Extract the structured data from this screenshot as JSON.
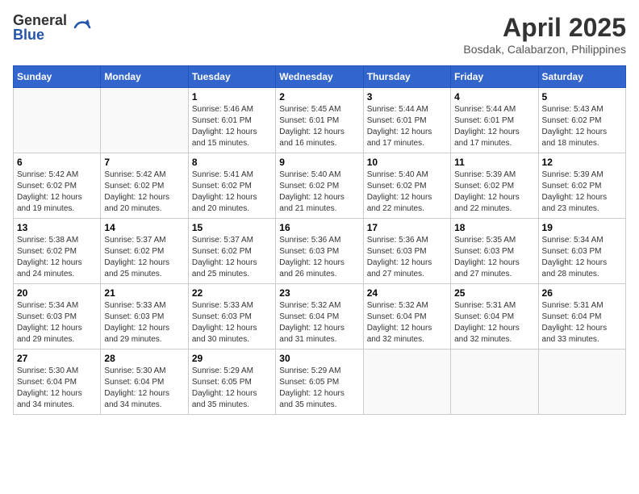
{
  "header": {
    "logo_general": "General",
    "logo_blue": "Blue",
    "title": "April 2025",
    "location": "Bosdak, Calabarzon, Philippines"
  },
  "weekdays": [
    "Sunday",
    "Monday",
    "Tuesday",
    "Wednesday",
    "Thursday",
    "Friday",
    "Saturday"
  ],
  "weeks": [
    [
      {
        "day": "",
        "info": ""
      },
      {
        "day": "",
        "info": ""
      },
      {
        "day": "1",
        "info": "Sunrise: 5:46 AM\nSunset: 6:01 PM\nDaylight: 12 hours and 15 minutes."
      },
      {
        "day": "2",
        "info": "Sunrise: 5:45 AM\nSunset: 6:01 PM\nDaylight: 12 hours and 16 minutes."
      },
      {
        "day": "3",
        "info": "Sunrise: 5:44 AM\nSunset: 6:01 PM\nDaylight: 12 hours and 17 minutes."
      },
      {
        "day": "4",
        "info": "Sunrise: 5:44 AM\nSunset: 6:01 PM\nDaylight: 12 hours and 17 minutes."
      },
      {
        "day": "5",
        "info": "Sunrise: 5:43 AM\nSunset: 6:02 PM\nDaylight: 12 hours and 18 minutes."
      }
    ],
    [
      {
        "day": "6",
        "info": "Sunrise: 5:42 AM\nSunset: 6:02 PM\nDaylight: 12 hours and 19 minutes."
      },
      {
        "day": "7",
        "info": "Sunrise: 5:42 AM\nSunset: 6:02 PM\nDaylight: 12 hours and 20 minutes."
      },
      {
        "day": "8",
        "info": "Sunrise: 5:41 AM\nSunset: 6:02 PM\nDaylight: 12 hours and 20 minutes."
      },
      {
        "day": "9",
        "info": "Sunrise: 5:40 AM\nSunset: 6:02 PM\nDaylight: 12 hours and 21 minutes."
      },
      {
        "day": "10",
        "info": "Sunrise: 5:40 AM\nSunset: 6:02 PM\nDaylight: 12 hours and 22 minutes."
      },
      {
        "day": "11",
        "info": "Sunrise: 5:39 AM\nSunset: 6:02 PM\nDaylight: 12 hours and 22 minutes."
      },
      {
        "day": "12",
        "info": "Sunrise: 5:39 AM\nSunset: 6:02 PM\nDaylight: 12 hours and 23 minutes."
      }
    ],
    [
      {
        "day": "13",
        "info": "Sunrise: 5:38 AM\nSunset: 6:02 PM\nDaylight: 12 hours and 24 minutes."
      },
      {
        "day": "14",
        "info": "Sunrise: 5:37 AM\nSunset: 6:02 PM\nDaylight: 12 hours and 25 minutes."
      },
      {
        "day": "15",
        "info": "Sunrise: 5:37 AM\nSunset: 6:02 PM\nDaylight: 12 hours and 25 minutes."
      },
      {
        "day": "16",
        "info": "Sunrise: 5:36 AM\nSunset: 6:03 PM\nDaylight: 12 hours and 26 minutes."
      },
      {
        "day": "17",
        "info": "Sunrise: 5:36 AM\nSunset: 6:03 PM\nDaylight: 12 hours and 27 minutes."
      },
      {
        "day": "18",
        "info": "Sunrise: 5:35 AM\nSunset: 6:03 PM\nDaylight: 12 hours and 27 minutes."
      },
      {
        "day": "19",
        "info": "Sunrise: 5:34 AM\nSunset: 6:03 PM\nDaylight: 12 hours and 28 minutes."
      }
    ],
    [
      {
        "day": "20",
        "info": "Sunrise: 5:34 AM\nSunset: 6:03 PM\nDaylight: 12 hours and 29 minutes."
      },
      {
        "day": "21",
        "info": "Sunrise: 5:33 AM\nSunset: 6:03 PM\nDaylight: 12 hours and 29 minutes."
      },
      {
        "day": "22",
        "info": "Sunrise: 5:33 AM\nSunset: 6:03 PM\nDaylight: 12 hours and 30 minutes."
      },
      {
        "day": "23",
        "info": "Sunrise: 5:32 AM\nSunset: 6:04 PM\nDaylight: 12 hours and 31 minutes."
      },
      {
        "day": "24",
        "info": "Sunrise: 5:32 AM\nSunset: 6:04 PM\nDaylight: 12 hours and 32 minutes."
      },
      {
        "day": "25",
        "info": "Sunrise: 5:31 AM\nSunset: 6:04 PM\nDaylight: 12 hours and 32 minutes."
      },
      {
        "day": "26",
        "info": "Sunrise: 5:31 AM\nSunset: 6:04 PM\nDaylight: 12 hours and 33 minutes."
      }
    ],
    [
      {
        "day": "27",
        "info": "Sunrise: 5:30 AM\nSunset: 6:04 PM\nDaylight: 12 hours and 34 minutes."
      },
      {
        "day": "28",
        "info": "Sunrise: 5:30 AM\nSunset: 6:04 PM\nDaylight: 12 hours and 34 minutes."
      },
      {
        "day": "29",
        "info": "Sunrise: 5:29 AM\nSunset: 6:05 PM\nDaylight: 12 hours and 35 minutes."
      },
      {
        "day": "30",
        "info": "Sunrise: 5:29 AM\nSunset: 6:05 PM\nDaylight: 12 hours and 35 minutes."
      },
      {
        "day": "",
        "info": ""
      },
      {
        "day": "",
        "info": ""
      },
      {
        "day": "",
        "info": ""
      }
    ]
  ]
}
